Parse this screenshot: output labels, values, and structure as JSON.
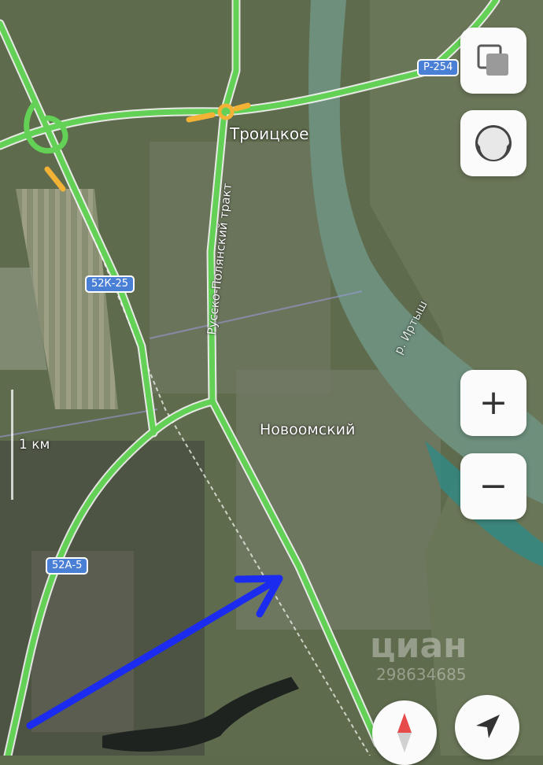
{
  "map": {
    "places": {
      "troitskoe": "Троицкое",
      "novoomsky": "Новоомский"
    },
    "road_name": "Русско-Полянский тракт",
    "river": "р. Иртыш",
    "shields": {
      "r254": "Р-254",
      "k52_25": "52К-25",
      "a52_5": "52А-5"
    },
    "scale": "1 км",
    "watermark": {
      "brand": "циан",
      "id": "298634685"
    }
  },
  "controls": {
    "layers": "layers-icon",
    "theme": "theme-toggle-icon",
    "zoom_in": "+",
    "zoom_out": "−",
    "compass": "compass-icon",
    "locate": "locate-arrow-icon"
  },
  "colors": {
    "road": "#63d156",
    "junction": "#f2b236",
    "river": "#6d8f7c",
    "shield": "#4a7fd6",
    "arrow": "#1b2bf0"
  }
}
